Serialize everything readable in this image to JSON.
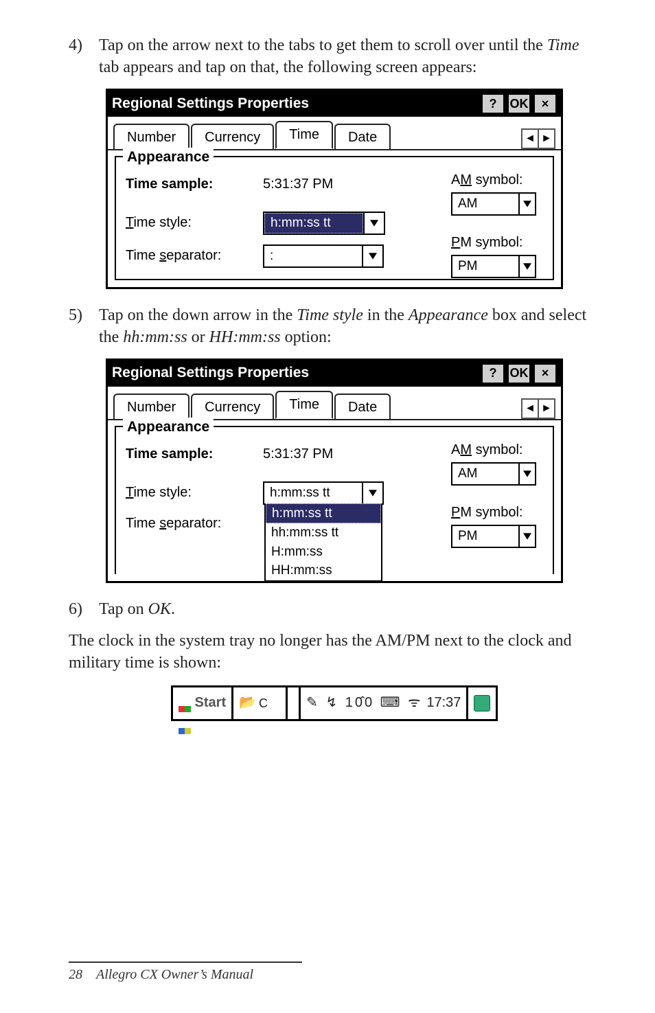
{
  "step4": {
    "num": "4)",
    "text_before": "Tap on the arrow next to the tabs to get them to scroll over until the ",
    "italic1": "Time",
    "text_after": " tab appears and tap on that, the following screen appears:"
  },
  "dialog1": {
    "title": "Regional Settings Properties",
    "help": "?",
    "ok": "OK",
    "close": "×",
    "tabs": {
      "number": "Number",
      "currency": "Currency",
      "time": "Time",
      "date": "Date"
    },
    "legend": "Appearance",
    "time_sample_label": "Time sample:",
    "time_sample_value": "5:31:37 PM",
    "time_style_label_pre": "T",
    "time_style_label_post": "ime style:",
    "time_style_value": "h:mm:ss tt",
    "time_sep_label_pre": "Time ",
    "time_sep_label_ul": "s",
    "time_sep_label_post": "eparator:",
    "time_sep_value": ":",
    "am_label_pre": "A",
    "am_label_ul": "M",
    "am_label_post": " symbol:",
    "am_value": "AM",
    "pm_label_ul": "P",
    "pm_label_post": "M symbol:",
    "pm_value": "PM"
  },
  "step5": {
    "num": "5)",
    "t1": "Tap on the down arrow in the ",
    "i1": "Time style",
    "t2": " in the ",
    "i2": "Appearance",
    "t3": " box and select the ",
    "i3": "hh:mm:ss",
    "t4": " or ",
    "i4": "HH:mm:ss",
    "t5": " option:"
  },
  "dialog2": {
    "title": "Regional Settings Properties",
    "help": "?",
    "ok": "OK",
    "close": "×",
    "tabs": {
      "number": "Number",
      "currency": "Currency",
      "time": "Time",
      "date": "Date"
    },
    "legend": "Appearance",
    "time_sample_label": "Time sample:",
    "time_sample_value": "5:31:37 PM",
    "time_style_label_pre": "T",
    "time_style_label_post": "ime style:",
    "time_style_value": "h:mm:ss tt",
    "opts": {
      "o1": "h:mm:ss tt",
      "o2": "hh:mm:ss tt",
      "o3": "H:mm:ss",
      "o4": "HH:mm:ss"
    },
    "time_sep_label_pre": "Time ",
    "time_sep_label_ul": "s",
    "time_sep_label_post": "eparator:",
    "am_label_pre": "A",
    "am_label_ul": "M",
    "am_label_post": " symbol:",
    "am_value": "AM",
    "pm_label_ul": "P",
    "pm_label_post": "M symbol:",
    "pm_value": "PM"
  },
  "step6": {
    "num": "6)",
    "t1": "Tap on ",
    "i1": "OK",
    "t2": "."
  },
  "para": "The clock in the system tray no longer has the AM/PM next to the clock and military time is shown:",
  "taskbar": {
    "start": "Start",
    "icons": "✎ ↯ 10̂0 ⌨ ᯤ",
    "clock": "17:37"
  },
  "footer": {
    "page": "28",
    "title": "Allegro CX Owner’s Manual"
  }
}
